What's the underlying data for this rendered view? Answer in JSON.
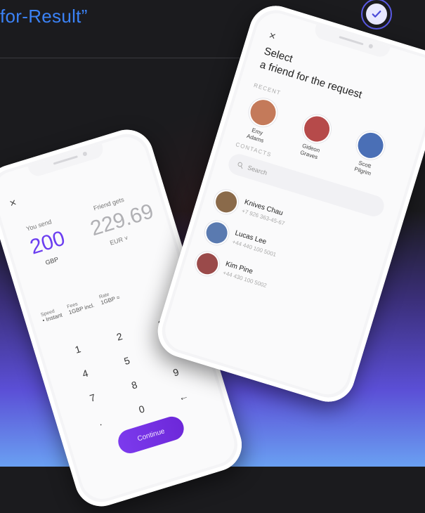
{
  "page": {
    "title": "for-Result”"
  },
  "left_screen": {
    "close": "×",
    "you_send_label": "You send",
    "you_send_amount": "200",
    "you_send_currency": "GBP",
    "friend_gets_label": "Friend gets",
    "friend_gets_amount": "229.69",
    "friend_gets_currency": "EUR ˅",
    "speed_label": "Speed",
    "speed_value": "• Instant",
    "fees_label": "Fees",
    "fees_value": "1GBP incl.",
    "rate_label": "Rate",
    "rate_value": "1GBP =",
    "keys": [
      "1",
      "2",
      "3",
      "4",
      "5",
      "6",
      "7",
      "8",
      "9",
      ".",
      "0",
      "←"
    ],
    "continue_label": "Continue"
  },
  "right_screen": {
    "close": "×",
    "heading_line1": "Select",
    "heading_line2": "a friend for the request",
    "recent_label": "RECENT",
    "recent": [
      {
        "name_line1": "Emy",
        "name_line2": "Adams",
        "color": "#c47a5a"
      },
      {
        "name_line1": "Gideon",
        "name_line2": "Graves",
        "color": "#b64a4a"
      },
      {
        "name_line1": "Scott",
        "name_line2": "Pilgrim",
        "color": "#4a6fb6"
      }
    ],
    "contacts_label": "CONTACTS",
    "search_placeholder": "Search",
    "contacts": [
      {
        "name": "Knives Chau",
        "phone": "+7 926 363-45-67",
        "color": "#8a6a4a"
      },
      {
        "name": "Lucas Lee",
        "phone": "+44 440 100 5001",
        "color": "#5a7ab0"
      },
      {
        "name": "Kim Pine",
        "phone": "+44 430 100 5002",
        "color": "#9a4a4a"
      }
    ]
  },
  "colors": {
    "accent": "#6b3df0",
    "title": "#3b82f6"
  }
}
